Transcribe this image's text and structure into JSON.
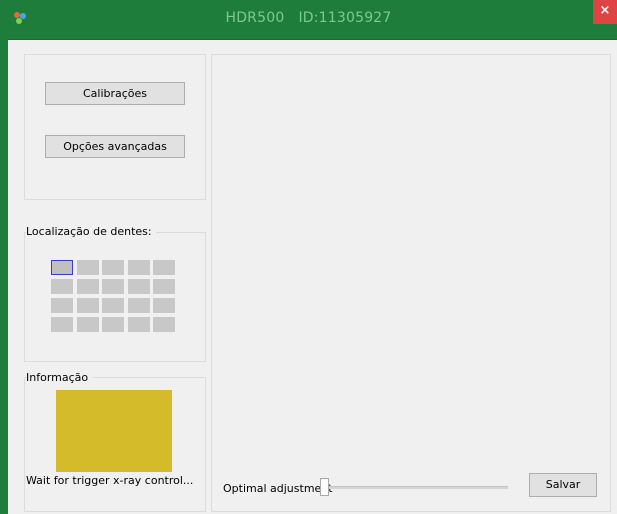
{
  "window": {
    "title_name": "HDR500",
    "title_id": "ID:11305927",
    "close_glyph": "×",
    "app_icon": "app-icon"
  },
  "left": {
    "calibrations_label": "Calibrações",
    "advanced_options_label": "Opções avançadas",
    "teeth_group_title": "Localização de dentes:",
    "teeth_grid": {
      "rows": 4,
      "cols": 5,
      "selected": [
        0,
        0
      ]
    },
    "info_group_title": "Informação",
    "status_color": "#d4bb29",
    "status_text": "Wait for trigger x-ray control..."
  },
  "bottom": {
    "adjustment_label": "Optimal adjustment",
    "adjustment_level": 0,
    "save_label": "Salvar"
  },
  "colors": {
    "frame": "#1e7d3a",
    "title_text": "#7ec98d",
    "close": "#e04343",
    "selection_border": "#3a3ad8"
  }
}
